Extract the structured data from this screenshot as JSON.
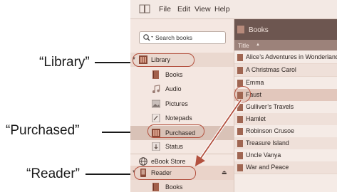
{
  "callouts": {
    "library": "“Library”",
    "purchased": "“Purchased”",
    "reader": "“Reader”"
  },
  "menubar": {
    "items": [
      "File",
      "Edit",
      "View",
      "Help"
    ]
  },
  "search": {
    "placeholder": "Search books"
  },
  "sidebar": {
    "library": "Library",
    "items": [
      "Books",
      "Audio",
      "Pictures",
      "Notepads",
      "Purchased",
      "Status"
    ],
    "ebook_store": "eBook Store",
    "reader": "Reader",
    "reader_books": "Books"
  },
  "list": {
    "header": "Books",
    "column": "Title",
    "books": [
      "Alice’s Adventures in Wonderland",
      "A Christmas Carol",
      "Emma",
      "Faust",
      "Gulliver’s Travels",
      "Hamlet",
      "Robinson Crusoe",
      "Treasure Island",
      "Uncle Vanya",
      "War and Peace"
    ]
  },
  "colors": {
    "accent": "#b3513f",
    "header": "#6d5650",
    "selection": "#e2c7bc"
  },
  "icons": [
    "app-book-icon",
    "search-icon",
    "library-icon",
    "books-icon",
    "audio-icon",
    "pictures-icon",
    "notepads-icon",
    "purchased-icon",
    "status-icon",
    "globe-icon",
    "reader-icon",
    "eject-icon"
  ]
}
